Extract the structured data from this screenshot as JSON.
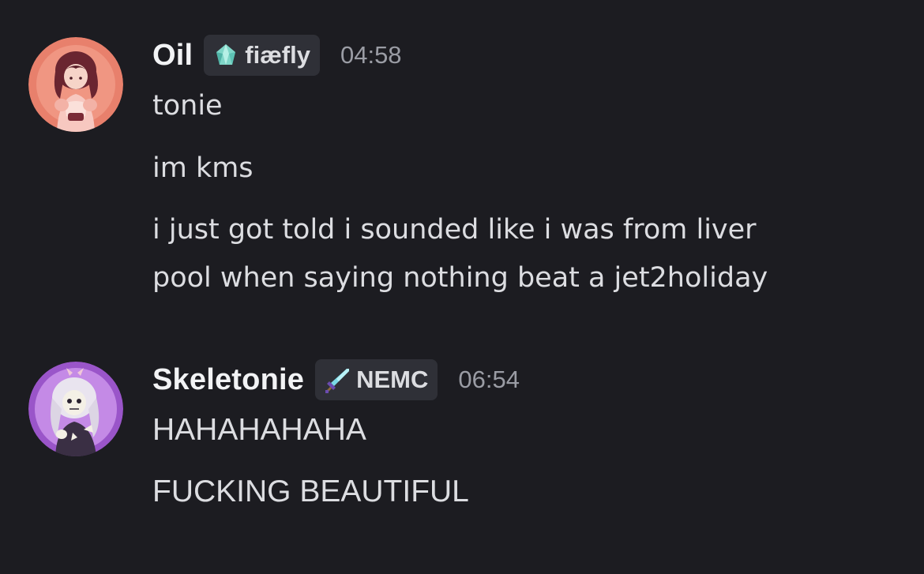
{
  "messages": [
    {
      "username": "Oil",
      "tag": {
        "icon": "firefly-gem-icon",
        "label": "fiæfly"
      },
      "timestamp": "04:58",
      "avatar_colors": {
        "bg": "#e8806c",
        "ring": "#f3a08e"
      },
      "lines": [
        "tonie",
        "im kms",
        "i just got told i sounded like i was from liver",
        "pool when saying nothing beat a jet2holiday"
      ]
    },
    {
      "username": "Skeletonie",
      "tag": {
        "icon": "diamond-sword-icon",
        "label": "NEMC"
      },
      "timestamp": "06:54",
      "avatar_colors": {
        "bg": "#b56de0",
        "ring": "#9a55c9"
      },
      "lines": [
        "HAHAHAHAHA",
        "FUCKING BEAUTIFUL"
      ]
    }
  ],
  "colors": {
    "background": "#1c1c21",
    "tag_bg": "#2f3037",
    "text": "#dcdde1",
    "timestamp": "#9a9ca4"
  }
}
